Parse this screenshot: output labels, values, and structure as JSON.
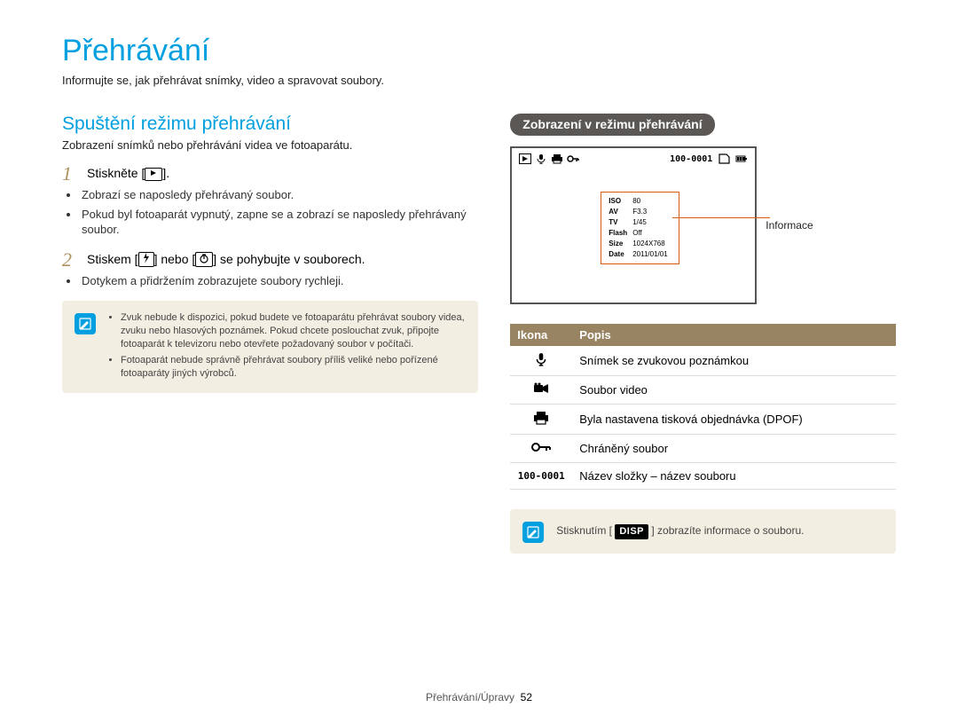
{
  "title": "Přehrávání",
  "subtitle": "Informujte se, jak přehrávat snímky, video a spravovat soubory.",
  "left": {
    "heading": "Spuštění režimu přehrávání",
    "intro": "Zobrazení snímků nebo přehrávání videa ve fotoaparátu.",
    "step1_num": "1",
    "step1_text_a": "Stiskněte [",
    "step1_text_b": "].",
    "step1_bullets": [
      "Zobrazí se naposledy přehrávaný soubor.",
      "Pokud byl fotoaparát vypnutý, zapne se a zobrazí se naposledy přehrávaný soubor."
    ],
    "step2_num": "2",
    "step2_text_a": "Stiskem [",
    "step2_text_b": "] nebo [",
    "step2_text_c": "] se pohybujte v souborech.",
    "step2_bullets": [
      "Dotykem a přidržením zobrazujete soubory rychleji."
    ],
    "note_items": [
      "Zvuk nebude k dispozici, pokud budete ve fotoaparátu přehrávat soubory videa, zvuku nebo hlasových poznámek. Pokud chcete poslouchat zvuk, připojte fotoaparát k televizoru nebo otevřete požadovaný soubor v počítači.",
      "Fotoaparát nebude správně přehrávat soubory příliš veliké nebo pořízené fotoaparáty jiných výrobců."
    ]
  },
  "right": {
    "pill": "Zobrazení v režimu přehrávání",
    "lcd_counter": "100-0001",
    "info_rows": [
      {
        "k": "ISO",
        "v": "80"
      },
      {
        "k": "AV",
        "v": "F3.3"
      },
      {
        "k": "TV",
        "v": "1/45"
      },
      {
        "k": "Flash",
        "v": "Off"
      },
      {
        "k": "Size",
        "v": "1024X768"
      },
      {
        "k": "Date",
        "v": "2011/01/01"
      }
    ],
    "info_label": "Informace",
    "table_head": {
      "col1": "Ikona",
      "col2": "Popis"
    },
    "table_rows": [
      {
        "icon": "mic",
        "desc": "Snímek se zvukovou poznámkou"
      },
      {
        "icon": "video",
        "desc": "Soubor video"
      },
      {
        "icon": "printer",
        "desc": "Byla nastavena tisková objednávka (DPOF)"
      },
      {
        "icon": "key",
        "desc": "Chráněný soubor"
      },
      {
        "icon": "counter",
        "label": "100-0001",
        "desc": "Název složky – název souboru"
      }
    ],
    "tip_a": "Stisknutím [",
    "tip_disp": "DISP",
    "tip_b": "] zobrazíte informace o souboru."
  },
  "footer": {
    "section": "Přehrávání/Úpravy",
    "page": "52"
  }
}
